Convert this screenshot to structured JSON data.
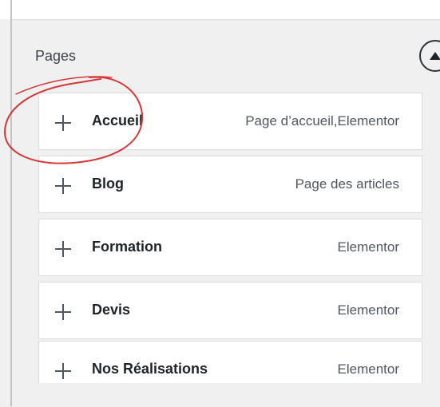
{
  "section": {
    "title": "Pages"
  },
  "pages": [
    {
      "name": "Accueil",
      "meta": "Page d’accueil,Elementor"
    },
    {
      "name": "Blog",
      "meta": "Page des articles"
    },
    {
      "name": "Formation",
      "meta": "Elementor"
    },
    {
      "name": "Devis",
      "meta": "Elementor"
    },
    {
      "name": "Nos Réalisations",
      "meta": "Elementor"
    }
  ],
  "icons": {
    "add": "plus-icon",
    "toggle": "caret-up-icon"
  },
  "colors": {
    "annotation": "#d63638",
    "panel_bg": "#f0f0f1",
    "item_bg": "#ffffff",
    "border": "#dcdcde"
  }
}
